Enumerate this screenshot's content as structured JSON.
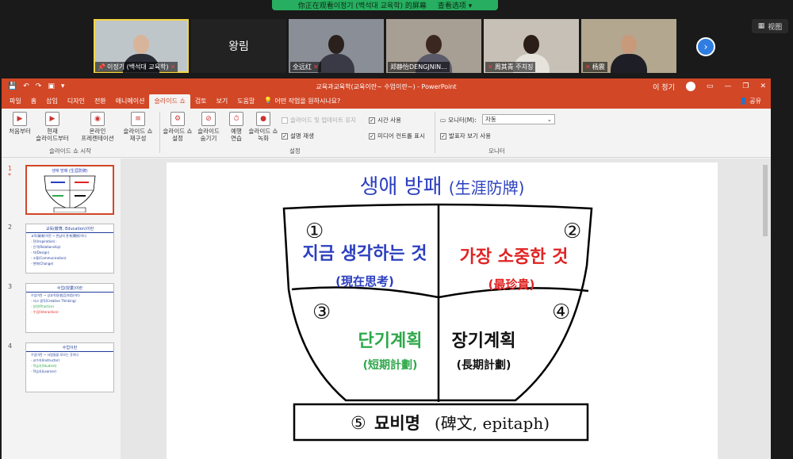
{
  "zoom": {
    "share_banner": "你正在观看이정기 (백석대 교육학) 的屏幕",
    "view_options": "查看选项",
    "view_button": "视图",
    "participants": [
      {
        "name": "이정기 (백석대 교육학)"
      },
      {
        "name": "왕림"
      },
      {
        "name": "全远红"
      },
      {
        "name": "郑静怡DENGJNIN..."
      },
      {
        "name": "周其青 주치징"
      },
      {
        "name": "杨震"
      }
    ]
  },
  "ppt": {
    "window_title": "교육과교육학(교육이란~ 수업이란~) - PowerPoint",
    "user": "이 정기",
    "share": "공유",
    "tabs": [
      "파일",
      "홈",
      "삽입",
      "디자인",
      "전환",
      "애니메이션",
      "슬라이드 쇼",
      "검토",
      "보기",
      "도움말"
    ],
    "tell_me": "어떤 작업을 원하시나요?",
    "ribbon": {
      "from_beginning": "처음부터",
      "from_current": "현재\n슬라이드부터",
      "online": "온라인\n프레젠테이션",
      "custom": "슬라이드 쇼\n재구성",
      "group_start": "슬라이드 쇼 시작",
      "setup": "슬라이드 쇼\n설정",
      "hide": "슬라이드\n숨기기",
      "rehearse": "예행\n연습",
      "record": "슬라이드 쇼\n녹화",
      "opt_update": "슬라이드 및 업데이트 유지",
      "opt_narration": "설명 재생",
      "opt_timings": "시간 사용",
      "opt_media": "미디어 컨트롤 표시",
      "group_setup": "설정",
      "monitor_label": "모니터(M):",
      "monitor_value": "자동",
      "presenter_view": "발표자 보기 사용",
      "group_monitor": "모니터"
    },
    "thumbnails": [
      {
        "num": "1",
        "title": "생애 방패 (生涯防牌)"
      },
      {
        "num": "2",
        "title": "교육(敎育, Education)이란",
        "lines": [
          "교육(敎育)이란 ~ 반납의 관계(關係)이다",
          "· 전(Inspiration) ·",
          "· 인격(Relationship)",
          "· 자(Design)",
          "· 소통(Communication)",
          "· 변화(Change)"
        ]
      },
      {
        "num": "3",
        "title": "수업(授業)이란",
        "lines": [
          "수업이란 ~ 상호작용(相互作用)이다",
          "· 사고 생각(Creative Thinking)",
          "· 실천(Practice)",
          "· 수업(Interaction)"
        ]
      },
      {
        "num": "4",
        "title": "수업이란",
        "lines": [
          "수업이란 ~ 사람들을 모으는 것이다",
          "· 교수자(Instructor)",
          "· 학습자(Student)",
          "· 학습자(Learner)"
        ]
      }
    ]
  },
  "slide": {
    "title": "생애 방패",
    "title_hanja": "(生涯防牌)",
    "q1_num": "①",
    "q1_main": "지금 생각하는 것",
    "q1_sub": "(現在思考)",
    "q2_num": "②",
    "q2_main": "가장 소중한 것",
    "q2_sub": "(最珍貴)",
    "q3_num": "③",
    "q3_main": "단기계획",
    "q3_sub": "(短期計劃)",
    "q4_num": "④",
    "q4_main": "장기계획",
    "q4_sub": "(長期計劃)",
    "epitaph_num": "⑤",
    "epitaph_main": "묘비명",
    "epitaph_rest": "(碑文, epitaph)",
    "colors": {
      "blue": "#2b3fbf",
      "red": "#e02323",
      "green": "#2ea84a",
      "black": "#111111"
    }
  }
}
